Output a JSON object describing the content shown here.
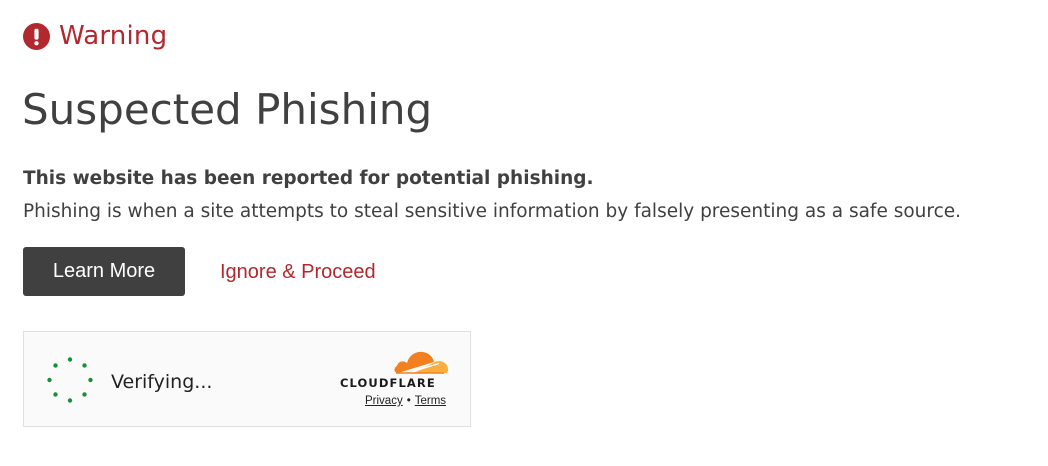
{
  "warning": {
    "label": "Warning",
    "icon": "exclamation-circle-icon",
    "color": "#b1282e"
  },
  "title": "Suspected Phishing",
  "lead": "This website has been reported for potential phishing.",
  "description": "Phishing is when a site attempts to steal sensitive information by falsely presenting as a safe source.",
  "actions": {
    "learn_more_label": "Learn More",
    "ignore_label": "Ignore & Proceed"
  },
  "challenge": {
    "status_text": "Verifying...",
    "spinner_icon": "loading-spinner-icon",
    "spinner_color": "#1a8f3b",
    "brand": "CLOUDFLARE",
    "brand_icon": "cloudflare-cloud-icon",
    "brand_color": "#f38020",
    "privacy_label": "Privacy",
    "separator": "•",
    "terms_label": "Terms"
  }
}
